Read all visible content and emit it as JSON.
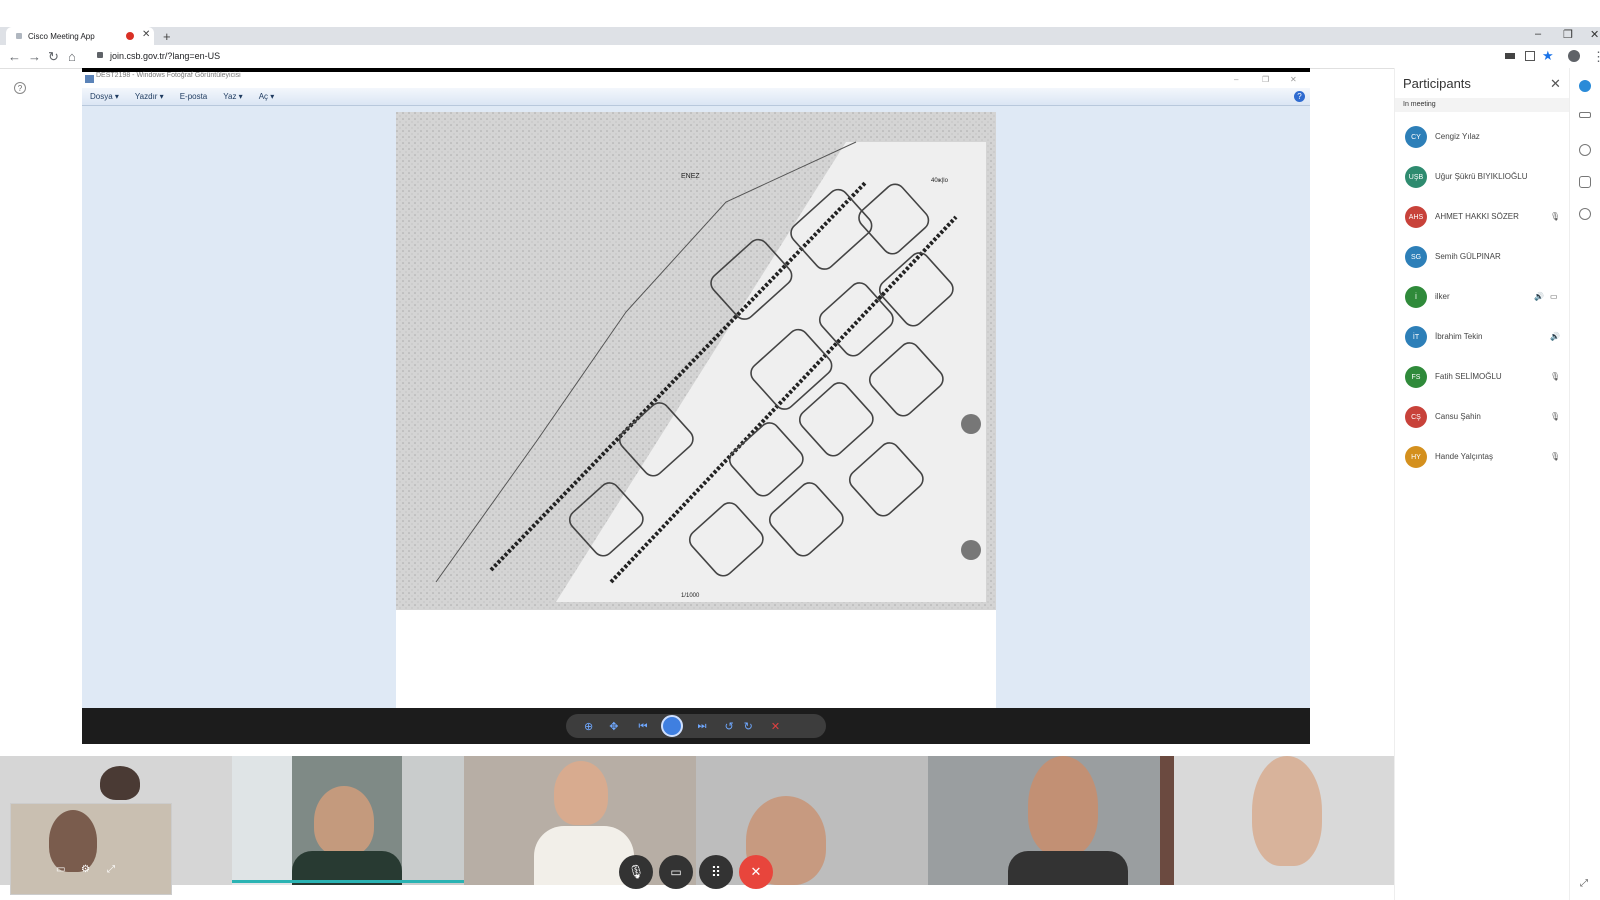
{
  "browser": {
    "tab_title": "Cisco Meeting App",
    "new_tab": "+",
    "url": "join.csb.gov.tr/?lang=en-US"
  },
  "viewer": {
    "title": "DEST2198 - Windows Fotoğraf Görüntüleyicisi",
    "menu": [
      "Dosya ▾",
      "Yazdır ▾",
      "E-posta",
      "Yaz ▾",
      "Aç ▾"
    ],
    "map_labels": {
      "top": "ENEZ",
      "right": "40ж|lo",
      "scale": "1/1000"
    }
  },
  "participants": {
    "title": "Participants",
    "section": "In meeting",
    "items": [
      {
        "initials": "CY",
        "name": "Cengiz Yılaz",
        "color": "#2d7fb8",
        "icons": []
      },
      {
        "initials": "UŞB",
        "name": "Uğur Şükrü BIYIKLIOĞLU",
        "color": "#2e8b6f",
        "icons": []
      },
      {
        "initials": "AHS",
        "name": "AHMET HAKKI SÖZER",
        "color": "#c8423a",
        "icons": [
          "mic-off"
        ]
      },
      {
        "initials": "SG",
        "name": "Semih GÜLPINAR",
        "color": "#2d7fb8",
        "icons": []
      },
      {
        "initials": "İ",
        "name": "ilker",
        "color": "#2f8a3a",
        "icons": [
          "speaker",
          "screen"
        ]
      },
      {
        "initials": "İT",
        "name": "İbrahim Tekin",
        "color": "#2d7fb8",
        "icons": [
          "speaker"
        ]
      },
      {
        "initials": "FS",
        "name": "Fatih SELİMOĞLU",
        "color": "#2f8a3a",
        "icons": [
          "mic-off"
        ]
      },
      {
        "initials": "CŞ",
        "name": "Cansu Şahin",
        "color": "#c8423a",
        "icons": [
          "mic-off"
        ]
      },
      {
        "initials": "HY",
        "name": "Hande Yalçıntaş",
        "color": "#d4901e",
        "icons": [
          "mic-off"
        ]
      }
    ]
  }
}
